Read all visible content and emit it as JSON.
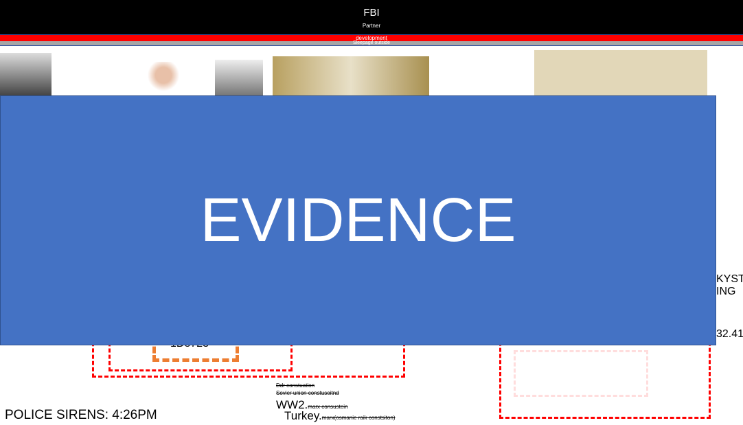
{
  "header": {
    "title": "FBI",
    "subtitle": "Partner"
  },
  "bars": {
    "red": "development",
    "gray": "Sleepage outside"
  },
  "evidence": "EVIDENCE",
  "box_code": "1D8723",
  "right_text": {
    "line1": "KYST",
    "line2": "ING",
    "number": "32.41"
  },
  "notes": {
    "n1": "Ddr constuation",
    "n2": "Sovier union constusoitnd",
    "ww2": "WW2.",
    "ww2_note": "marx consustein",
    "turkey": "Turkey.",
    "turkey_note": "marx(osmanie raik constsiton)"
  },
  "police": "POLICE SIRENS: 4:26PM"
}
